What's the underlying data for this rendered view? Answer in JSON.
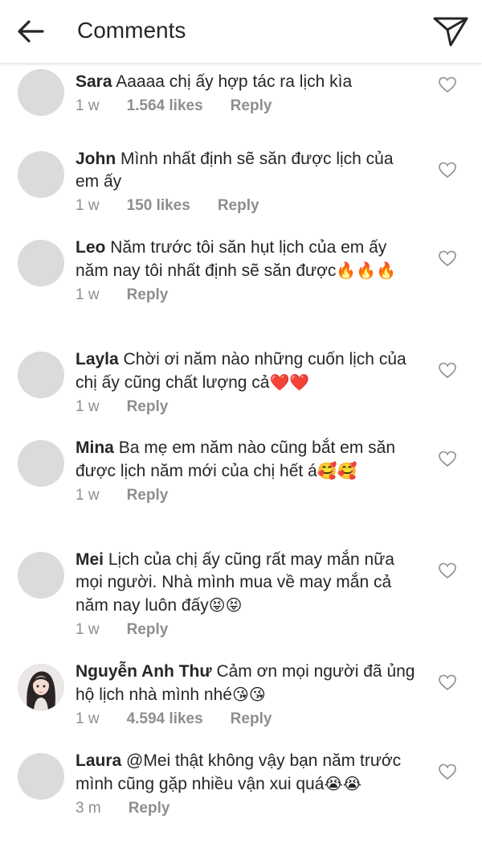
{
  "header": {
    "title": "Comments",
    "back_icon": "arrow-left-icon",
    "share_icon": "paper-plane-icon"
  },
  "comments": [
    {
      "user": "Sara",
      "text": "Aaaaa chị ấy hợp tác ra lịch kìa",
      "emojis": "",
      "time": "1 w",
      "likes": "1.564 likes",
      "reply": "Reply",
      "avatar": "default"
    },
    {
      "user": "John",
      "text": "Mình nhất định sẽ săn được lịch của em ấy",
      "emojis": "",
      "time": "1 w",
      "likes": "150 likes",
      "reply": "Reply",
      "avatar": "default"
    },
    {
      "user": "Leo",
      "text": "Năm trước tôi săn hụt lịch của em ấy năm nay tôi nhất định sẽ săn được",
      "emojis": "🔥🔥🔥",
      "time": "1 w",
      "likes": "",
      "reply": "Reply",
      "avatar": "default"
    },
    {
      "user": "Layla",
      "text": "Chời ơi năm nào những cuốn lịch của chị ấy cũng chất lượng cả",
      "emojis": "❤️❤️",
      "time": "1 w",
      "likes": "",
      "reply": "Reply",
      "avatar": "default"
    },
    {
      "user": "Mina",
      "text": "Ba mẹ em năm nào cũng bắt em săn được lịch năm mới của chị hết á",
      "emojis": "🥰🥰",
      "time": "1 w",
      "likes": "",
      "reply": "Reply",
      "avatar": "default"
    },
    {
      "user": "Mei",
      "text": "Lịch của chị ấy cũng rất may mắn nữa mọi người. Nhà mình mua về may mắn cả năm nay luôn đấy",
      "emojis": "😝😝",
      "time": "1 w",
      "likes": "",
      "reply": "Reply",
      "avatar": "default"
    },
    {
      "user": "Nguyễn Anh Thư",
      "text": "Cảm ơn mọi người đã ủng hộ lịch nhà mình nhé",
      "emojis": "😘😘",
      "time": "1 w",
      "likes": "4.594 likes",
      "reply": "Reply",
      "avatar": "photo"
    },
    {
      "user": "Laura",
      "text": "@Mei thật không vậy bạn năm trước mình cũng gặp nhiều vận xui quá",
      "emojis": "😭😭",
      "time": "3 m",
      "likes": "",
      "reply": "Reply",
      "avatar": "default"
    }
  ],
  "colors": {
    "text": "#262626",
    "muted": "#8e8e8e",
    "avatar_bg": "#dbdbdb"
  }
}
